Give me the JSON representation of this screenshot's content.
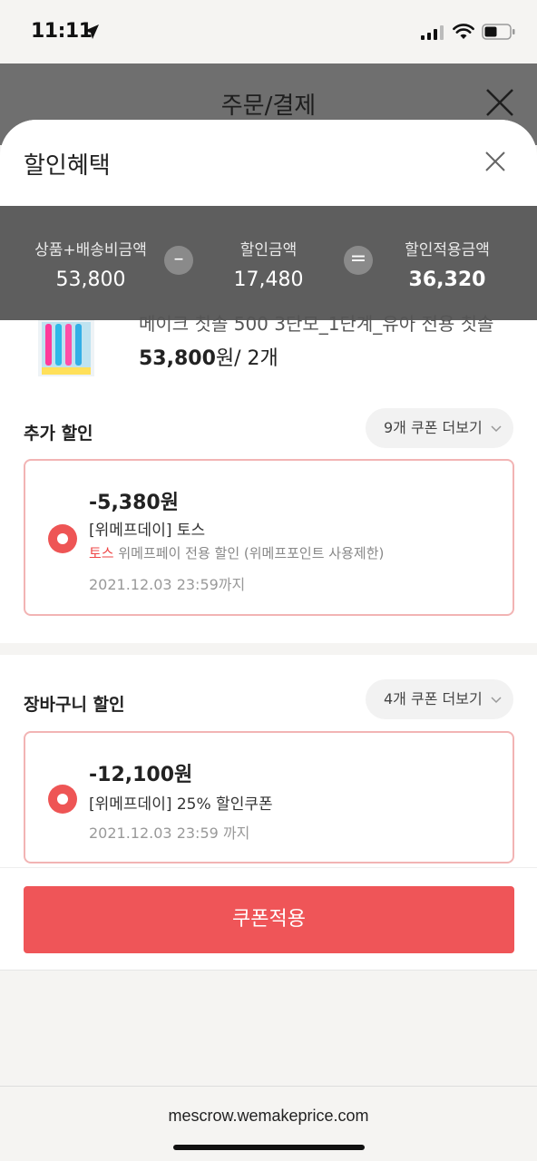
{
  "status": {
    "time": "11:11"
  },
  "order": {
    "title": "주문/결제"
  },
  "sheet": {
    "title": "할인혜택",
    "summary": {
      "goods_label": "상품+배송비금액",
      "goods_value": "53,800",
      "minus_symbol": "–",
      "discount_label": "할인금액",
      "discount_value": "17,480",
      "equals_symbol": "=",
      "final_label": "할인적용금액",
      "final_value": "36,320"
    },
    "product": {
      "name_partial": "메이크 칫솔 500 3단모_1단계_유아 전용 칫솔",
      "price": "53,800",
      "price_suffix": "원/ 2개"
    },
    "extra_discount": {
      "title": "추가 할인",
      "more_label": "9개 쿠폰 더보기",
      "coupon": {
        "amount": "-5,380원",
        "name": "[위메프데이] 토스",
        "desc_highlight": "토스",
        "desc_rest": " 위메프페이 전용 할인 (위메프포인트 사용제한)",
        "date": "2021.12.03 23:59까지"
      }
    },
    "cart_discount": {
      "title": "장바구니 할인",
      "more_label": "4개 쿠폰 더보기",
      "coupon": {
        "amount": "-12,100원",
        "name": "[위메프데이] 25% 할인쿠폰",
        "date": "2021.12.03 23:59 까지"
      }
    },
    "apply_label": "쿠폰적용"
  },
  "browser": {
    "url": "mescrow.wemakeprice.com"
  },
  "colors": {
    "accent": "#ef5558",
    "coupon_border": "#f2b4b4",
    "summary_bg": "#5e5e5e"
  }
}
